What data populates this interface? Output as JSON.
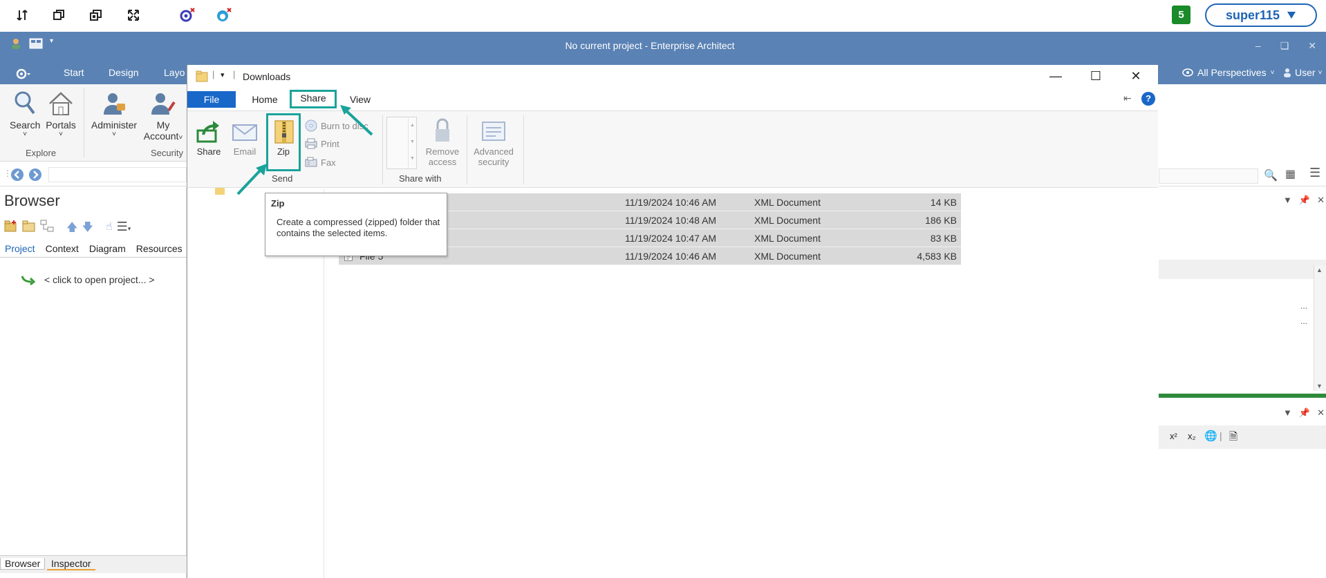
{
  "remote_toolbar": {
    "session_count": "5",
    "user_label": "super115"
  },
  "ea": {
    "window_title": "No current project - Enterprise Architect",
    "tabs": [
      "Start",
      "Design",
      "Layo"
    ],
    "perspectives_label": "All Perspectives",
    "user_menu_label": "User",
    "ribbon": {
      "search": "Search",
      "portals": "Portals",
      "administer": "Administer",
      "my_account_1": "My",
      "my_account_2": "Account",
      "group_explore": "Explore",
      "group_security": "Security"
    },
    "browser": {
      "title": "Browser",
      "subtabs": [
        "Project",
        "Context",
        "Diagram",
        "Resources"
      ],
      "open_project": "< click to open project... >",
      "bottom_tab_browser": "Browser",
      "bottom_tab_inspector": "Inspector"
    },
    "right_panel": {
      "ellipsis_1": "...",
      "ellipsis_2": "..."
    }
  },
  "explorer": {
    "path": "Downloads",
    "tabs": {
      "file": "File",
      "home": "Home",
      "share": "Share",
      "view": "View"
    },
    "ribbon": {
      "share": "Share",
      "email": "Email",
      "zip": "Zip",
      "burn": "Burn to disc",
      "print": "Print",
      "fax": "Fax",
      "group_send": "Send",
      "remove_1": "Remove",
      "remove_2": "access",
      "advanced_1": "Advanced",
      "advanced_2": "security",
      "group_share_with": "Share with"
    },
    "files": [
      {
        "name": "",
        "date": "11/19/2024 10:46 AM",
        "type": "XML Document",
        "size": "14 KB"
      },
      {
        "name": "",
        "date": "11/19/2024 10:48 AM",
        "type": "XML Document",
        "size": "186 KB"
      },
      {
        "name": "",
        "date": "11/19/2024 10:47 AM",
        "type": "XML Document",
        "size": "83 KB"
      },
      {
        "name": "File 5",
        "date": "11/19/2024 10:46 AM",
        "type": "XML Document",
        "size": "4,583 KB"
      }
    ],
    "tooltip": {
      "title": "Zip",
      "body": "Create a compressed (zipped) folder that contains the selected items."
    }
  },
  "colors": {
    "ea_blue": "#5a82b4",
    "accent_teal": "#1aa39b",
    "file_tab_blue": "#1967c8",
    "user_blue": "#1e64b4"
  }
}
